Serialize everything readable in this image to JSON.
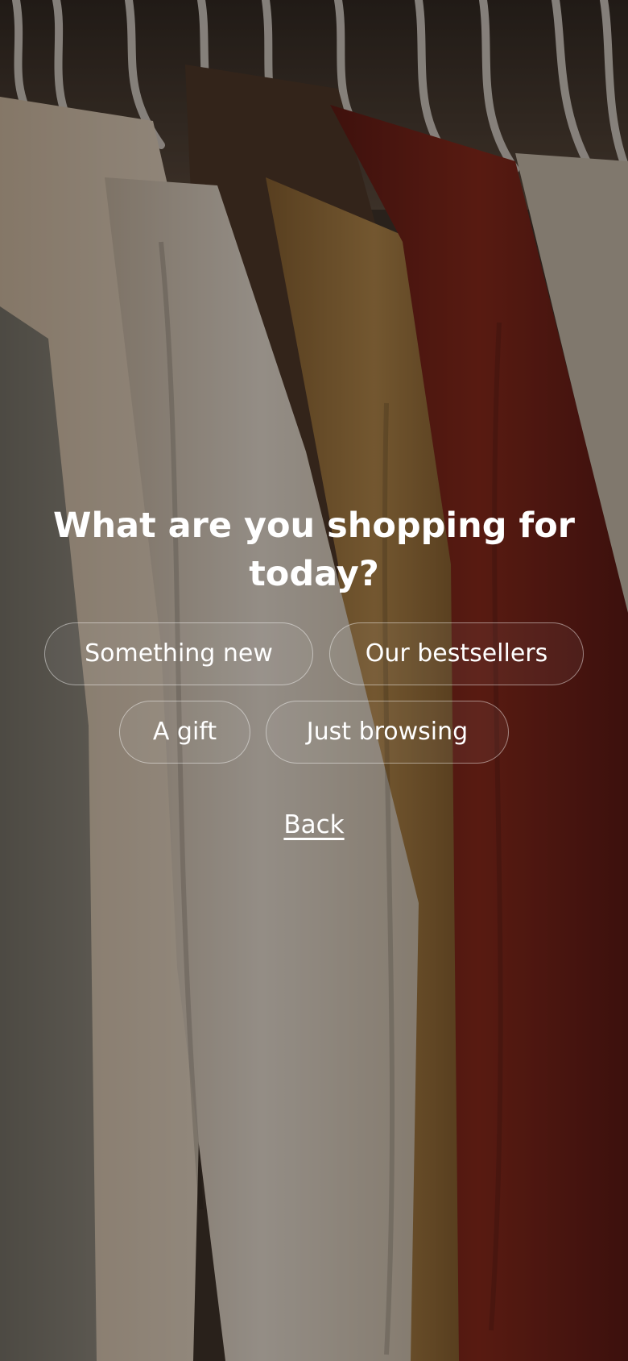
{
  "question": {
    "title": "What are you shopping for today?"
  },
  "options": [
    {
      "label": "Something new"
    },
    {
      "label": "Our bestsellers"
    },
    {
      "label": "A gift"
    },
    {
      "label": "Just browsing"
    }
  ],
  "back_label": "Back",
  "colors": {
    "text": "#ffffff",
    "pill_border": "rgba(255,255,255,0.45)",
    "overlay": "rgba(20,14,10,0.42)",
    "red_sweater": "#7a1a14",
    "mustard_knit": "#a77a3e",
    "cream_coat": "#e8ddd0",
    "grey_knit": "#6e6b63"
  }
}
